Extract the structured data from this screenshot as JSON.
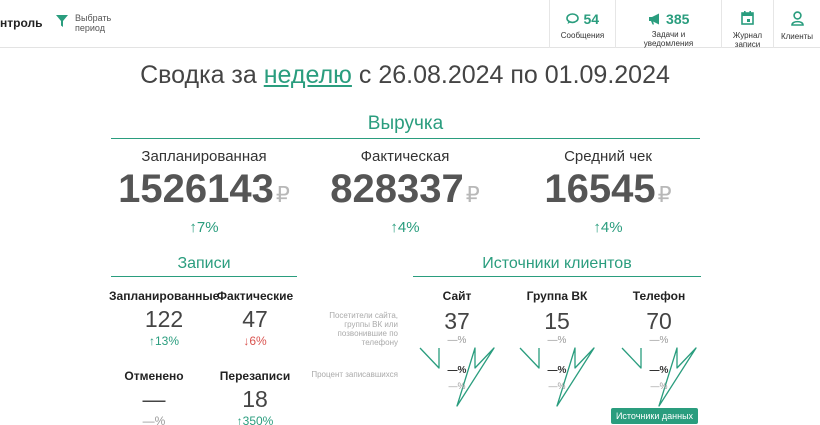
{
  "header": {
    "brand": "нтроль",
    "period_button": "Выбрать период",
    "nav": [
      {
        "count": "54",
        "label": "Сообщения",
        "icon": "chat-icon"
      },
      {
        "count": "385",
        "label": "Задачи и уведомления",
        "icon": "megaphone-icon"
      },
      {
        "label": "Журнал записи",
        "icon": "calendar-icon"
      },
      {
        "label": "Клиенты",
        "icon": "user-icon"
      }
    ]
  },
  "summary": {
    "prefix": "Сводка за",
    "period_link": "неделю",
    "range": "с 26.08.2024 по 01.09.2024"
  },
  "revenue": {
    "title": "Выручка",
    "currency": "₽",
    "items": [
      {
        "label": "Запланированная",
        "value": "1526143",
        "change": "↑7%"
      },
      {
        "label": "Фактическая",
        "value": "828337",
        "change": "↑4%"
      },
      {
        "label": "Средний чек",
        "value": "16545",
        "change": "↑4%"
      }
    ]
  },
  "records": {
    "title": "Записи",
    "items": [
      {
        "label": "Запланированные",
        "value": "122",
        "change": "↑13%"
      },
      {
        "label": "Фактические",
        "value": "47",
        "change": "↓6%"
      },
      {
        "label": "Отменено",
        "value": "—",
        "change": "—%"
      },
      {
        "label": "Перезаписи",
        "value": "18",
        "change": "↑350%"
      }
    ]
  },
  "sources": {
    "title": "Источники клиентов",
    "note_visitors": "Посетители сайта, группы ВК или позвонившие по телефону",
    "note_booked": "Процент записавшихся",
    "channels": [
      {
        "label": "Сайт",
        "value": "37",
        "pct1": "—%",
        "pct2": "—%",
        "pct3": "—%"
      },
      {
        "label": "Группа ВК",
        "value": "15",
        "pct1": "—%",
        "pct2": "—%",
        "pct3": "—%"
      },
      {
        "label": "Телефон",
        "value": "70",
        "pct1": "—%",
        "pct2": "—%",
        "pct3": "—%"
      }
    ],
    "data_sources_button": "Источники данных"
  },
  "colors": {
    "accent": "#2a9d7e",
    "down": "#d9534f",
    "muted": "#999999"
  }
}
